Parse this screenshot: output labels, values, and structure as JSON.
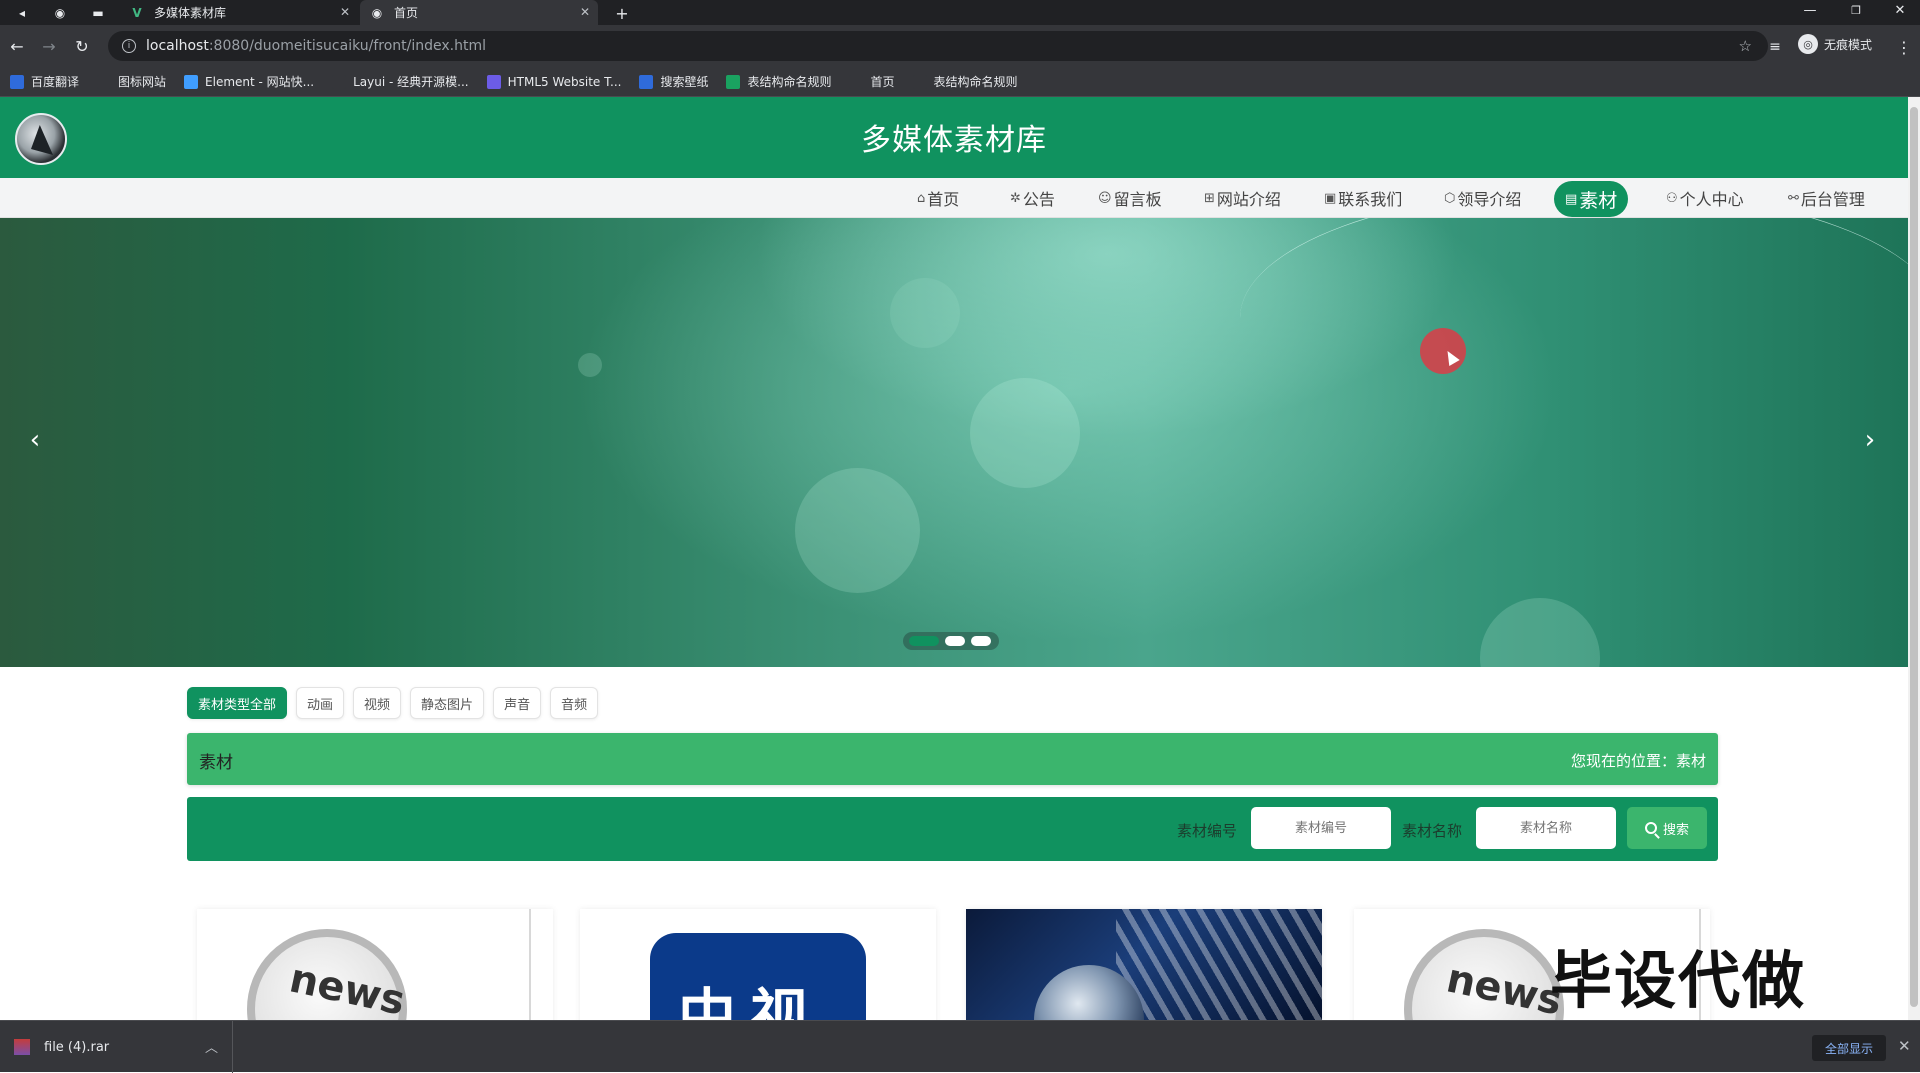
{
  "browser": {
    "tabs": [
      {
        "title": "多媒体素材库",
        "favicon": "vue-icon",
        "active": false
      },
      {
        "title": "首页",
        "favicon": "globe-icon",
        "active": true
      }
    ],
    "new_tab": "+",
    "url_host": "localhost",
    "url_path": ":8080/duomeitisucaiku/front/index.html",
    "profile_label": "无痕模式",
    "bookmarks": [
      {
        "label": "百度翻译",
        "icon": "baidu-translate-icon",
        "color": "#2f6bdb"
      },
      {
        "label": "图标网站",
        "icon": "flag-icon",
        "color": "#35363a"
      },
      {
        "label": "Element - 网站快...",
        "icon": "element-icon",
        "color": "#409eff"
      },
      {
        "label": "Layui - 经典开源模...",
        "icon": "layui-icon",
        "color": "#35363a"
      },
      {
        "label": "HTML5 Website T...",
        "icon": "html5-icon",
        "color": "#6c5ce7"
      },
      {
        "label": "搜索壁纸",
        "icon": "wallpaper-icon",
        "color": "#2f6bdb"
      },
      {
        "label": "表结构命名规则",
        "icon": "sheet-icon",
        "color": "#1aa260"
      },
      {
        "label": "首页",
        "icon": "globe-icon",
        "color": "#35363a"
      },
      {
        "label": "表结构命名规则",
        "icon": "globe-icon",
        "color": "#35363a"
      }
    ]
  },
  "site": {
    "title": "多媒体素材库",
    "brand_color": "#10925f",
    "accent_color": "#3bb56d",
    "nav": [
      {
        "label": "首页",
        "icon": "home-icon",
        "active": false
      },
      {
        "label": "公告",
        "icon": "bell-icon",
        "active": false
      },
      {
        "label": "留言板",
        "icon": "message-icon",
        "active": false
      },
      {
        "label": "网站介绍",
        "icon": "gift-icon",
        "active": false
      },
      {
        "label": "联系我们",
        "icon": "contact-icon",
        "active": false
      },
      {
        "label": "领导介绍",
        "icon": "shield-icon",
        "active": false
      },
      {
        "label": "素材",
        "icon": "monitor-icon",
        "active": true
      },
      {
        "label": "个人中心",
        "icon": "user-icon",
        "active": false
      },
      {
        "label": "后台管理",
        "icon": "link-icon",
        "active": false
      }
    ]
  },
  "banner": {
    "slides": 3,
    "active_slide": 1,
    "prev_arrow": "‹",
    "next_arrow": "›"
  },
  "filters": [
    {
      "label": "素材类型全部",
      "active": true
    },
    {
      "label": "动画",
      "active": false
    },
    {
      "label": "视频",
      "active": false
    },
    {
      "label": "静态图片",
      "active": false
    },
    {
      "label": "声音",
      "active": false
    },
    {
      "label": "音频",
      "active": false
    }
  ],
  "section": {
    "title": "素材",
    "breadcrumb": "您现在的位置：素材"
  },
  "search": {
    "code_label": "素材编号",
    "code_placeholder": "素材编号",
    "name_label": "素材名称",
    "name_placeholder": "素材名称",
    "button_label": "搜索"
  },
  "cards": [
    {
      "thumb": "news-thumbnail",
      "text": "news"
    },
    {
      "thumb": "cctv-thumbnail",
      "text": "中视"
    },
    {
      "thumb": "globe-news-thumbnail",
      "text": ""
    },
    {
      "thumb": "news-thumbnail",
      "text": "news"
    }
  ],
  "watermark": "毕设代做",
  "downloads": {
    "file": "file (4).rar",
    "show_all": "全部显示"
  }
}
